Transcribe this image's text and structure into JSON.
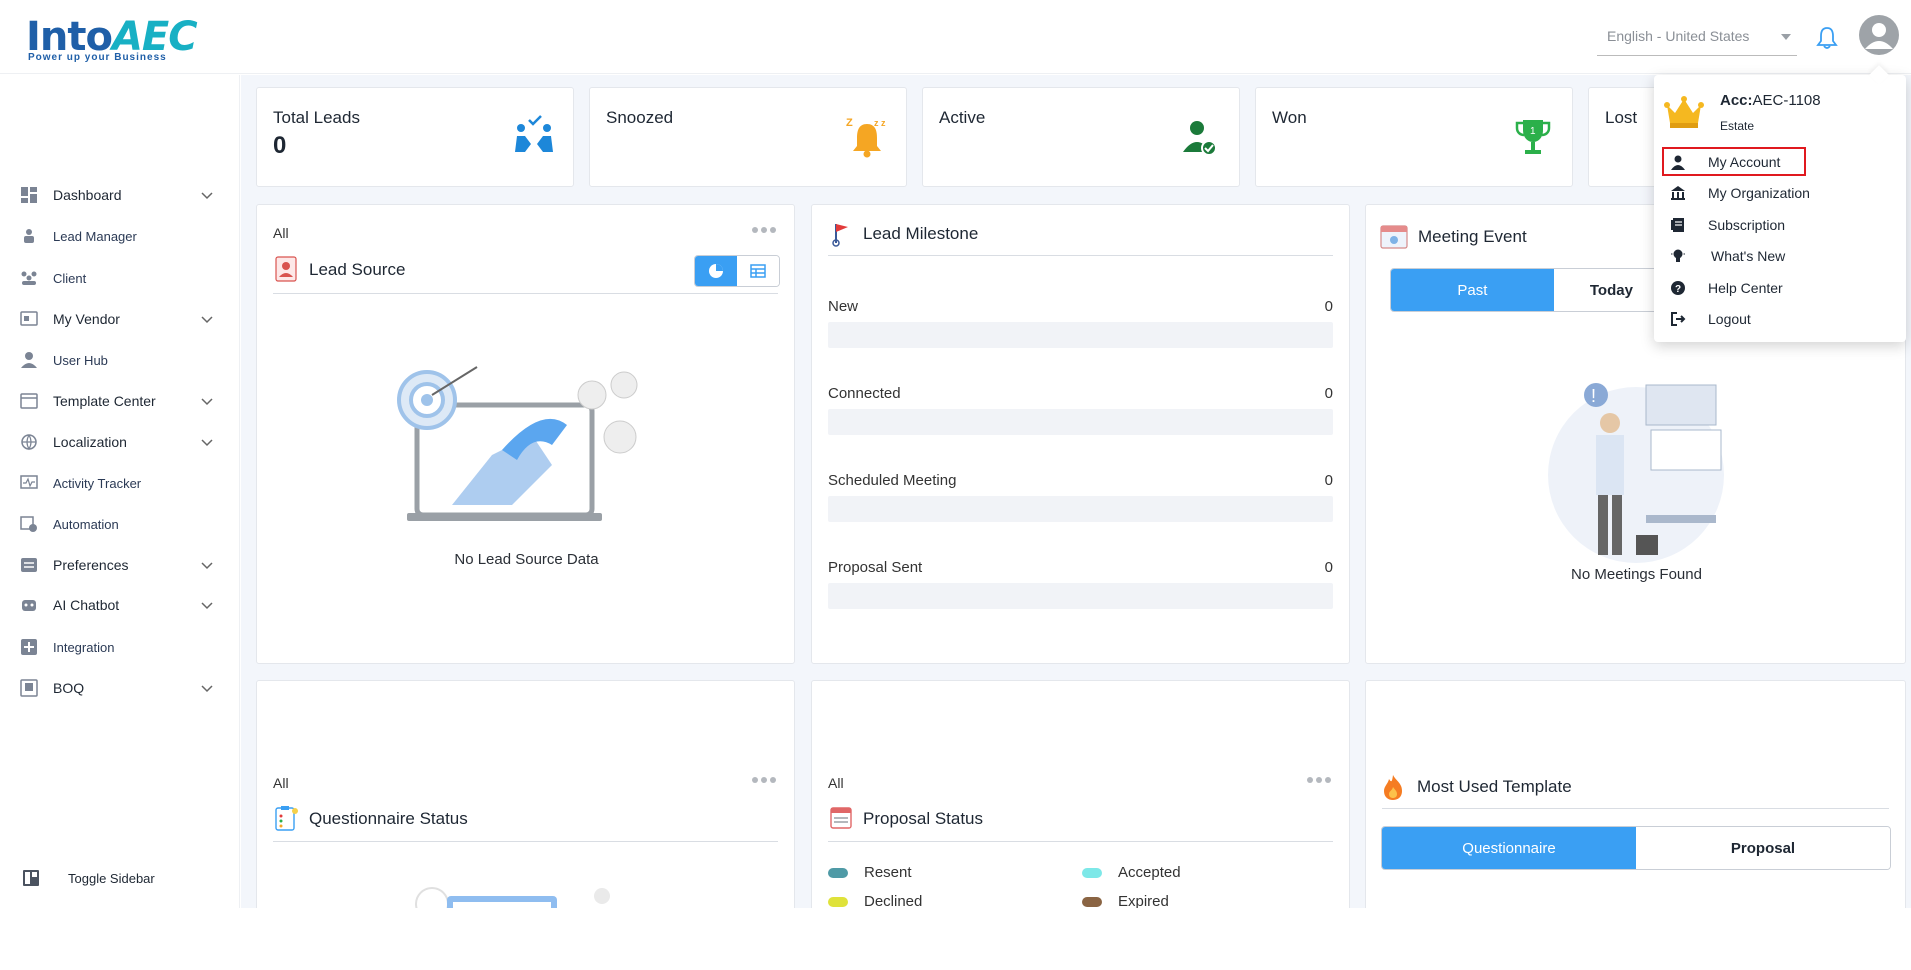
{
  "header": {
    "logo_text_main": "Into",
    "logo_text_accent": "AEC",
    "logo_tagline": "Power up your Business",
    "language": "English - United States"
  },
  "sidebar": {
    "items": [
      {
        "label": "Dashboard",
        "icon": "dashboard-icon",
        "has_chevron": true
      },
      {
        "label": "Lead Manager",
        "icon": "lead-manager-icon",
        "has_chevron": false
      },
      {
        "label": "Client",
        "icon": "client-icon",
        "has_chevron": false
      },
      {
        "label": "My Vendor",
        "icon": "vendor-icon",
        "has_chevron": true
      },
      {
        "label": "User Hub",
        "icon": "user-icon",
        "has_chevron": false
      },
      {
        "label": "Template Center",
        "icon": "template-icon",
        "has_chevron": true
      },
      {
        "label": "Localization",
        "icon": "localization-icon",
        "has_chevron": true
      },
      {
        "label": "Activity Tracker",
        "icon": "activity-icon",
        "has_chevron": false
      },
      {
        "label": "Automation",
        "icon": "automation-icon",
        "has_chevron": false
      },
      {
        "label": "Preferences",
        "icon": "preferences-icon",
        "has_chevron": true
      },
      {
        "label": "AI Chatbot",
        "icon": "chatbot-icon",
        "has_chevron": true
      },
      {
        "label": "Integration",
        "icon": "integration-icon",
        "has_chevron": false
      },
      {
        "label": "BOQ",
        "icon": "boq-icon",
        "has_chevron": true
      }
    ],
    "toggle_label": "Toggle Sidebar"
  },
  "stats": [
    {
      "title": "Total Leads",
      "value": "0"
    },
    {
      "title": "Snoozed",
      "value": ""
    },
    {
      "title": "Active",
      "value": ""
    },
    {
      "title": "Won",
      "value": ""
    },
    {
      "title": "Lost",
      "value": ""
    }
  ],
  "lead_source": {
    "filter": "All",
    "title": "Lead Source",
    "empty": "No Lead Source Data"
  },
  "lead_milestone": {
    "title": "Lead Milestone",
    "rows": [
      {
        "label": "New",
        "count": "0"
      },
      {
        "label": "Connected",
        "count": "0"
      },
      {
        "label": "Scheduled Meeting",
        "count": "0"
      },
      {
        "label": "Proposal Sent",
        "count": "0"
      }
    ]
  },
  "meeting_event": {
    "title": "Meeting Event",
    "tabs": [
      "Past",
      "Today"
    ],
    "active_tab": "Past",
    "empty": "No Meetings Found"
  },
  "questionnaire_status": {
    "filter": "All",
    "title": "Questionnaire Status"
  },
  "proposal_status": {
    "filter": "All",
    "title": "Proposal Status",
    "legend": [
      {
        "label": "Resent",
        "color": "#4f9aa6"
      },
      {
        "label": "Accepted",
        "color": "#7de8e8"
      },
      {
        "label": "Declined",
        "color": "#dfe23a"
      },
      {
        "label": "Expired",
        "color": "#8a6443"
      }
    ]
  },
  "most_used_template": {
    "title": "Most Used Template",
    "tabs": [
      "Questionnaire",
      "Proposal"
    ],
    "active_tab": "Questionnaire"
  },
  "account_menu": {
    "acc_label": "Acc:",
    "acc_id": "AEC-1108",
    "acc_sub": "Estate",
    "items": [
      {
        "label": "My Account",
        "icon": "person-icon"
      },
      {
        "label": "My Organization",
        "icon": "organization-icon"
      },
      {
        "label": "Subscription",
        "icon": "subscription-icon"
      },
      {
        "label": "What's New",
        "icon": "bulb-icon"
      },
      {
        "label": "Help Center",
        "icon": "help-icon"
      },
      {
        "label": "Logout",
        "icon": "logout-icon"
      }
    ]
  },
  "colors": {
    "accent": "#3a9ff3",
    "brand": "#1f5fa8",
    "highlight_border": "#e0191f"
  }
}
